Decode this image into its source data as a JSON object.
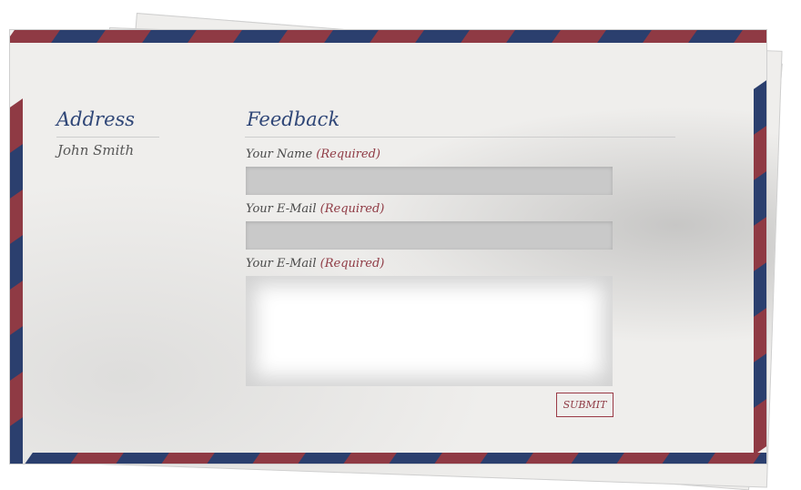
{
  "address": {
    "heading": "Address",
    "name": "John Smith"
  },
  "feedback": {
    "heading": "Feedback",
    "fields": [
      {
        "label": "Your Name ",
        "required": "(Required)",
        "value": ""
      },
      {
        "label": "Your E-Mail  ",
        "required": "(Required)",
        "value": ""
      },
      {
        "label": "Your E-Mail  ",
        "required": "(Required)",
        "value": ""
      }
    ],
    "submit_label": "SUBMIT"
  },
  "colors": {
    "stripe_red": "#8f3a44",
    "stripe_blue": "#2b3f6e",
    "heading_blue": "#2f4677",
    "required_red": "#8f3a44"
  }
}
